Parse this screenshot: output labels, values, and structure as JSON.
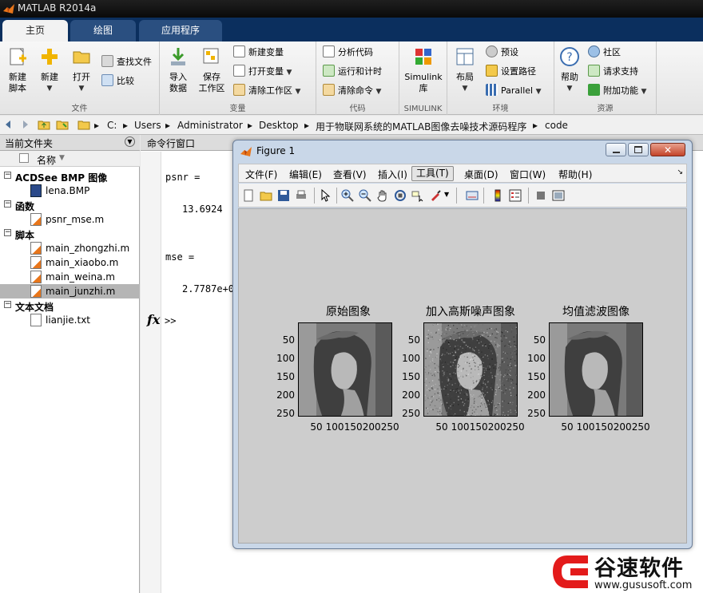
{
  "window": {
    "title": "MATLAB R2014a"
  },
  "ribbon": {
    "tabs": [
      {
        "label": "主页"
      },
      {
        "label": "绘图"
      },
      {
        "label": "应用程序"
      }
    ],
    "file_group": {
      "name": "文件",
      "new_script": "新建\n脚本",
      "new": "新建",
      "open": "打开",
      "find_files": "查找文件",
      "compare": "比较"
    },
    "variable_group": {
      "name": "变量",
      "import_data": "导入\n数据",
      "save_workspace": "保存\n工作区",
      "new_variable": "新建变量",
      "open_variable": "打开变量",
      "clear_workspace": "清除工作区"
    },
    "code_group": {
      "name": "代码",
      "analyze": "分析代码",
      "run_time": "运行和计时",
      "clear_commands": "清除命令"
    },
    "simulink_group": {
      "name": "SIMULINK",
      "library": "Simulink\n库"
    },
    "env_group": {
      "name": "环境",
      "layout": "布局",
      "preferences": "预设",
      "set_path": "设置路径",
      "parallel": "Parallel"
    },
    "resources_group": {
      "name": "资源",
      "help": "帮助",
      "community": "社区",
      "request_support": "请求支持",
      "addons": "附加功能"
    }
  },
  "address": {
    "crumbs": [
      "C:",
      "Users",
      "Administrator",
      "Desktop",
      "用于物联网系统的MATLAB图像去噪技术源码程序",
      "code"
    ]
  },
  "current_folder": {
    "title": "当前文件夹",
    "column": "名称",
    "groups": [
      {
        "label": "ACDSee BMP 图像",
        "files": [
          {
            "name": "lena.BMP",
            "selected": false
          }
        ]
      },
      {
        "label": "函数",
        "files": [
          {
            "name": "psnr_mse.m",
            "selected": false
          }
        ]
      },
      {
        "label": "脚本",
        "files": [
          {
            "name": "main_zhongzhi.m",
            "selected": false
          },
          {
            "name": "main_xiaobo.m",
            "selected": false
          },
          {
            "name": "main_weina.m",
            "selected": false
          },
          {
            "name": "main_junzhi.m",
            "selected": true
          }
        ]
      },
      {
        "label": "文本文档",
        "files": [
          {
            "name": "lianjie.txt",
            "selected": false
          }
        ]
      }
    ]
  },
  "command_window": {
    "title": "命令行窗口",
    "lines": [
      "psnr =",
      "13.6924",
      "mse =",
      "2.7787e+0"
    ],
    "prompt": ">>",
    "fx": "fx"
  },
  "figure": {
    "title": "Figure 1",
    "menu": [
      "文件(F)",
      "编辑(E)",
      "查看(V)",
      "插入(I)",
      "工具(T)",
      "桌面(D)",
      "窗口(W)",
      "帮助(H)"
    ],
    "active_menu": "工具(T)",
    "axes": [
      {
        "title": "原始图象",
        "noisy": false
      },
      {
        "title": "加入高斯噪声图象",
        "noisy": true
      },
      {
        "title": "均值滤波图像",
        "noisy": false
      }
    ],
    "y_ticks": [
      "50",
      "100",
      "150",
      "200",
      "250"
    ],
    "x_ticks": [
      "50",
      "100",
      "150",
      "200",
      "250"
    ]
  },
  "watermark": {
    "brand": "谷速软件",
    "url": "www.gususoft.com"
  }
}
